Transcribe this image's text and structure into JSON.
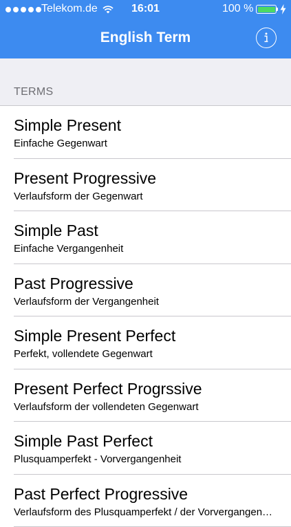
{
  "status_bar": {
    "carrier": "Telekom.de",
    "time": "16:01",
    "battery_percent": "100 %",
    "battery_level": 1.0,
    "signal_bars": 5
  },
  "nav": {
    "title": "English Term",
    "info_icon": "info-circle-icon"
  },
  "section": {
    "header": "TERMS"
  },
  "terms": [
    {
      "title": "Simple Present",
      "subtitle": "Einfache Gegenwart"
    },
    {
      "title": "Present Progressive",
      "subtitle": "Verlaufsform der Gegenwart"
    },
    {
      "title": "Simple Past",
      "subtitle": "Einfache Vergangenheit"
    },
    {
      "title": "Past Progressive",
      "subtitle": "Verlaufsform der Vergangenheit"
    },
    {
      "title": "Simple Present Perfect",
      "subtitle": "Perfekt, vollendete Gegenwart"
    },
    {
      "title": "Present Perfect Progrssive",
      "subtitle": "Verlaufsform der vollendeten Gegenwart"
    },
    {
      "title": "Simple Past Perfect",
      "subtitle": "Plusquamperfekt - Vorvergangenheit"
    },
    {
      "title": "Past Perfect Progressive",
      "subtitle": "Verlaufsform des Plusquamperfekt / der Vorvergangenheit"
    }
  ],
  "colors": {
    "nav_bar": "#3d8bf0",
    "section_bg": "#efeff4",
    "separator": "#c8c7cc",
    "battery_fill": "#4cd964"
  }
}
